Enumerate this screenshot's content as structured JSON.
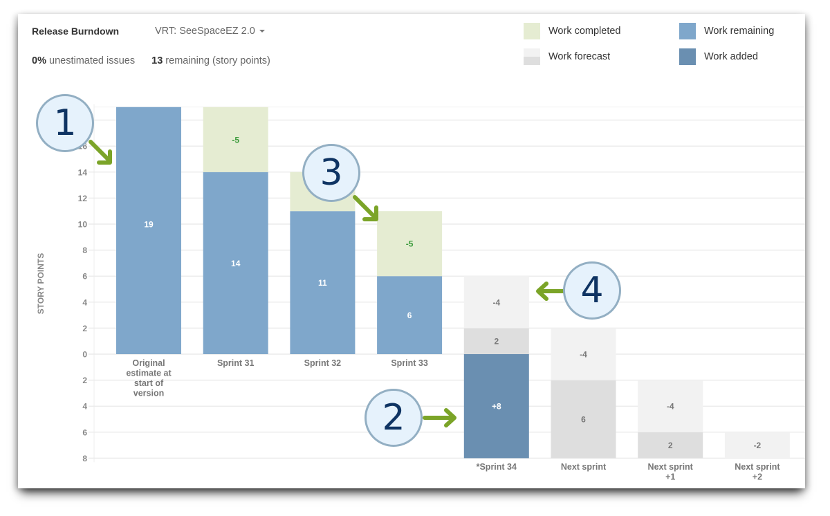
{
  "header": {
    "title": "Release Burndown",
    "version_selector": "VRT: SeeSpaceEZ 2.0",
    "unestimated_value": "0%",
    "unestimated_label": "unestimated issues",
    "remaining_value": "13",
    "remaining_label": "remaining (story points)"
  },
  "legend": [
    {
      "label": "Work completed",
      "color": "#e5ecd2"
    },
    {
      "label": "Work remaining",
      "color": "#7fa7cb"
    },
    {
      "label": "Work forecast",
      "color": "#f2f2f2"
    },
    {
      "label": "Work added",
      "color": "#6a8fb1"
    }
  ],
  "callouts": [
    "1",
    "2",
    "3",
    "4"
  ],
  "chart_data": {
    "type": "bar",
    "title": "Release Burndown",
    "ylabel": "STORY POINTS",
    "xlabel": "",
    "ylim": [
      -8,
      19
    ],
    "yticks": [
      {
        "value": 18,
        "label": "18"
      },
      {
        "value": 16,
        "label": "16"
      },
      {
        "value": 14,
        "label": "14"
      },
      {
        "value": 12,
        "label": "12"
      },
      {
        "value": 10,
        "label": "10"
      },
      {
        "value": 8,
        "label": "8"
      },
      {
        "value": 6,
        "label": "6"
      },
      {
        "value": 4,
        "label": "4"
      },
      {
        "value": 2,
        "label": "2"
      },
      {
        "value": 0,
        "label": "0"
      },
      {
        "value": -2,
        "label": "2"
      },
      {
        "value": -4,
        "label": "4"
      },
      {
        "value": -6,
        "label": "6"
      },
      {
        "value": -8,
        "label": "8"
      }
    ],
    "grid": true,
    "legend_position": "top-right",
    "colors": {
      "completed": "#e5ecd2",
      "remaining": "#7fa7cb",
      "added": "#6a8fb1",
      "forecast_light": "#f2f2f2",
      "forecast_dark": "#dedede",
      "completed_label": "#3a9a3a"
    },
    "categories": [
      {
        "label": [
          "Original",
          "estimate at",
          "start of",
          "version"
        ],
        "label_pos": "below-zero"
      },
      {
        "label": [
          "Sprint 31"
        ],
        "label_pos": "below-zero"
      },
      {
        "label": [
          "Sprint 32"
        ],
        "label_pos": "below-zero"
      },
      {
        "label": [
          "Sprint 33"
        ],
        "label_pos": "below-zero"
      },
      {
        "label": [
          "*Sprint 34"
        ],
        "label_pos": "bottom"
      },
      {
        "label": [
          "Next sprint"
        ],
        "label_pos": "bottom"
      },
      {
        "label": [
          "Next sprint",
          "+1"
        ],
        "label_pos": "bottom"
      },
      {
        "label": [
          "Next sprint",
          "+2"
        ],
        "label_pos": "bottom"
      }
    ],
    "segments": [
      {
        "cat": 0,
        "series": "remaining",
        "from": 0,
        "to": 19,
        "label": "19",
        "label_at": 10,
        "label_color": "#ffffff"
      },
      {
        "cat": 1,
        "series": "remaining",
        "from": 0,
        "to": 14,
        "label": "14",
        "label_at": 7,
        "label_color": "#ffffff"
      },
      {
        "cat": 1,
        "series": "completed",
        "from": 14,
        "to": 19,
        "label": "-5",
        "label_at": 16.5,
        "label_color": "#3a9a3a"
      },
      {
        "cat": 2,
        "series": "remaining",
        "from": 0,
        "to": 11,
        "label": "11",
        "label_at": 5.5,
        "label_color": "#ffffff"
      },
      {
        "cat": 2,
        "series": "completed",
        "from": 11,
        "to": 14,
        "label": "",
        "label_at": 12.5,
        "label_color": "#3a9a3a"
      },
      {
        "cat": 3,
        "series": "remaining",
        "from": 0,
        "to": 6,
        "label": "6",
        "label_at": 3,
        "label_color": "#ffffff"
      },
      {
        "cat": 3,
        "series": "completed",
        "from": 6,
        "to": 11,
        "label": "-5",
        "label_at": 8.5,
        "label_color": "#3a9a3a"
      },
      {
        "cat": 4,
        "series": "added",
        "from": -8,
        "to": 0,
        "label": "+8",
        "label_at": -4,
        "label_color": "#ffffff"
      },
      {
        "cat": 4,
        "series": "forecast_dark",
        "from": 0,
        "to": 2,
        "label": "2",
        "label_at": 1,
        "label_color": "#777777"
      },
      {
        "cat": 4,
        "series": "forecast_light",
        "from": 2,
        "to": 6,
        "label": "-4",
        "label_at": 4,
        "label_color": "#777777"
      },
      {
        "cat": 5,
        "series": "forecast_dark",
        "from": -8,
        "to": -2,
        "label": "6",
        "label_at": -5,
        "label_color": "#777777"
      },
      {
        "cat": 5,
        "series": "forecast_light",
        "from": -2,
        "to": 2,
        "label": "-4",
        "label_at": 0,
        "label_color": "#777777"
      },
      {
        "cat": 6,
        "series": "forecast_dark",
        "from": -8,
        "to": -6,
        "label": "2",
        "label_at": -7,
        "label_color": "#777777"
      },
      {
        "cat": 6,
        "series": "forecast_light",
        "from": -6,
        "to": -2,
        "label": "-4",
        "label_at": -4,
        "label_color": "#777777"
      },
      {
        "cat": 7,
        "series": "forecast_light",
        "from": -8,
        "to": -6,
        "label": "-2",
        "label_at": -7,
        "label_color": "#777777"
      }
    ]
  }
}
